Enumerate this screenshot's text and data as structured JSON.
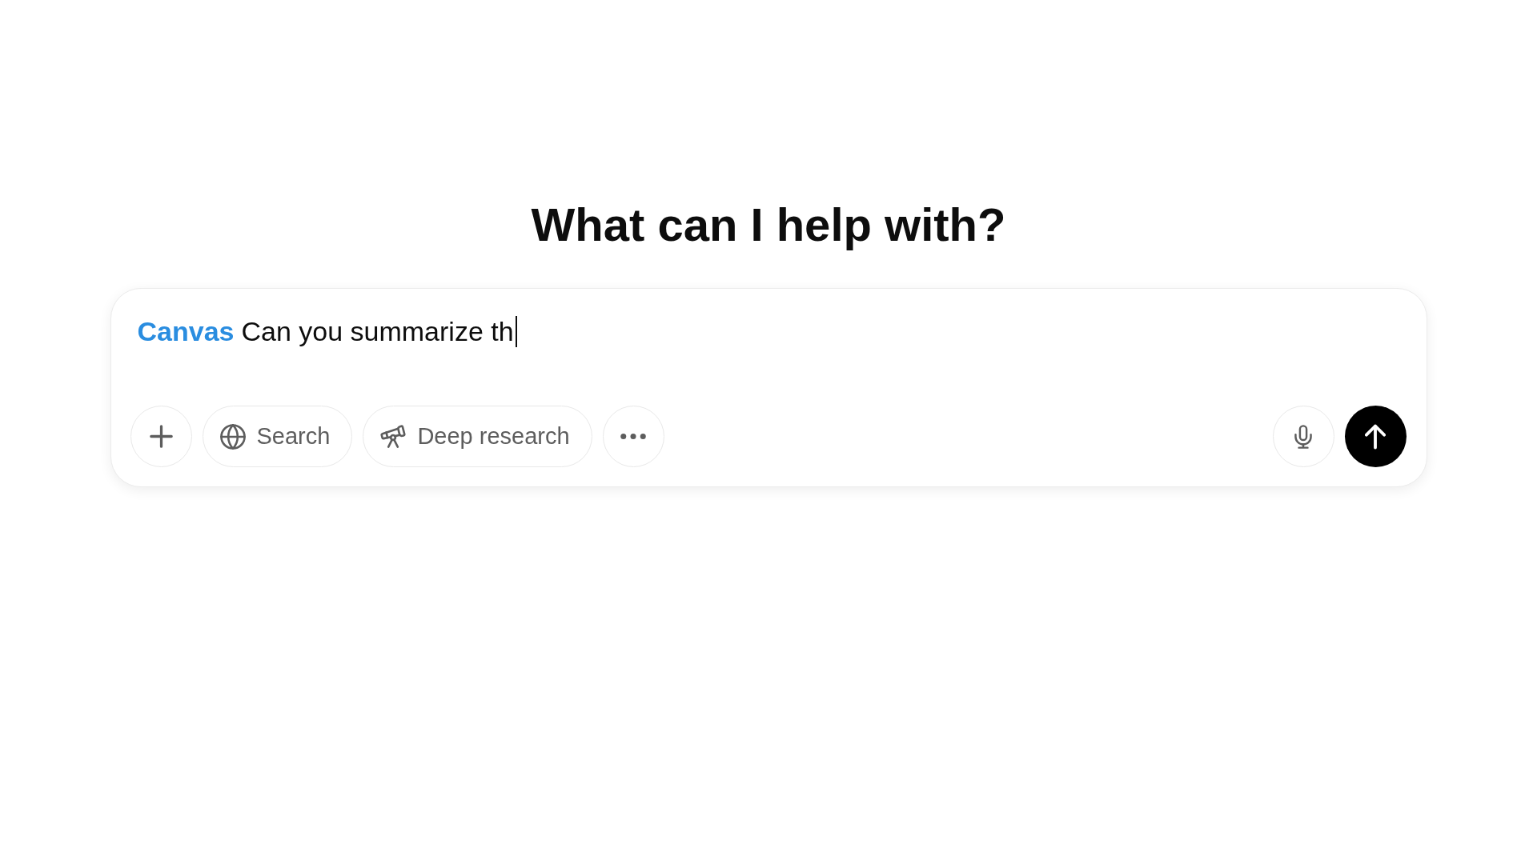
{
  "heading": "What can I help with?",
  "composer": {
    "tool_tag": "Canvas",
    "value": "Can you summarize th",
    "focused": true,
    "tools": [
      {
        "kind": "search",
        "label": "Search",
        "selected": false
      },
      {
        "kind": "research",
        "label": "Deep research",
        "selected": false
      }
    ]
  }
}
